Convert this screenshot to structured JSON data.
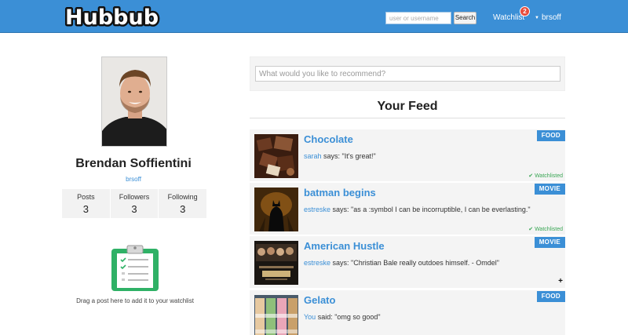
{
  "header": {
    "logo_text": "Hubbub",
    "search_placeholder": "user or username",
    "search_button": "Search",
    "watchlist_label": "Watchlist",
    "watchlist_count": "2",
    "username": "brsoff",
    "colors": {
      "bar": "#3b8fd6",
      "badge": "#e74c3c"
    }
  },
  "profile": {
    "name": "Brendan Soffientini",
    "handle": "brsoff",
    "stats": [
      {
        "label": "Posts",
        "value": "3"
      },
      {
        "label": "Followers",
        "value": "3"
      },
      {
        "label": "Following",
        "value": "3"
      }
    ],
    "drop_hint": "Drag a post here to add it to your watchlist",
    "drop_icon": "clipboard-checklist-icon"
  },
  "composer": {
    "placeholder": "What would you like to recommend?"
  },
  "feed": {
    "title": "Your Feed",
    "posts": [
      {
        "title": "Chocolate",
        "user": "sarah",
        "verb": " says: ",
        "quote": "\"It's great!\"",
        "tag": "FOOD",
        "status": "✔ Watchlisted"
      },
      {
        "title": "batman begins",
        "user": "estreske",
        "verb": " says: ",
        "quote": "\"as a :symbol I can be incorruptible, I can be everlasting.\"",
        "tag": "MOVIE",
        "status": "✔ Watchlisted"
      },
      {
        "title": "American Hustle",
        "user": "estreske",
        "verb": " says: ",
        "quote": "\"Christian Bale really outdoes himself. - Omdel\"",
        "tag": "MOVIE",
        "action": "+"
      },
      {
        "title": "Gelato",
        "user": "You",
        "verb": " said: ",
        "quote": "\"omg so good\"",
        "tag": "FOOD"
      }
    ]
  }
}
